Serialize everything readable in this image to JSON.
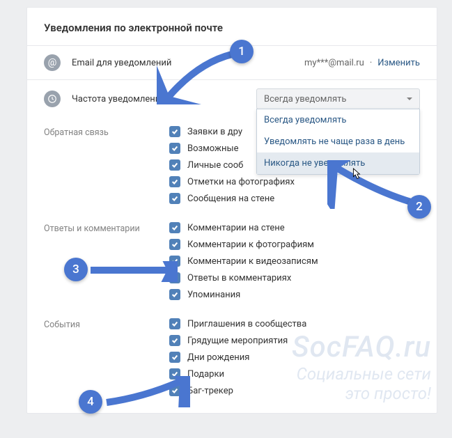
{
  "title": "Уведомления по электронной почте",
  "email_row": {
    "label": "Email для уведомлений",
    "value": "my***@mail.ru",
    "change": "Изменить"
  },
  "freq_row": {
    "label": "Частота уведомлений",
    "selected": "Всегда уведомлять",
    "options": [
      "Всегда уведомлять",
      "Уведомлять не чаще раза в день",
      "Никогда не уведомлять"
    ]
  },
  "sections": [
    {
      "label": "Обратная связь",
      "items": [
        "Заявки в дру",
        "Возможные",
        "Личные сооб",
        "Отметки на фотографиях",
        "Сообщения на стене"
      ]
    },
    {
      "label": "Ответы и комментарии",
      "items": [
        "Комментарии на стене",
        "Комментарии к фотографиям",
        "Комментарии к видеозаписям",
        "Ответы в комментариях",
        "Упоминания"
      ]
    },
    {
      "label": "События",
      "items": [
        "Приглашения в сообщества",
        "Грядущие мероприятия",
        "Дни рождения",
        "Подарки",
        "Баг-трекер"
      ]
    }
  ],
  "watermark": {
    "line1": "SocFAQ.ru",
    "line2": "Социальные сети",
    "line3": "это просто!"
  },
  "annotations": {
    "b1": "1",
    "b2": "2",
    "b3": "3",
    "b4": "4"
  }
}
